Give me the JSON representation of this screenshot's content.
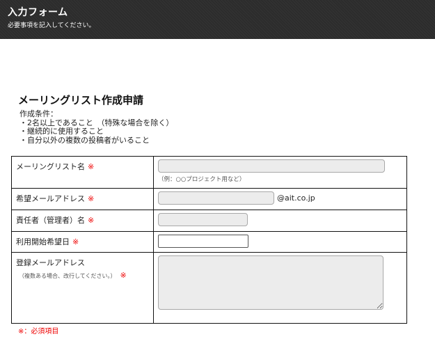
{
  "header": {
    "title": "入力フォーム",
    "subtitle": "必要事項を記入してください。"
  },
  "form": {
    "title": "メーリングリスト作成申請",
    "conditions_heading": "作成条件：",
    "conditions": [
      "・2名以上であること　（特殊な場合を除く）",
      "・継続的に使用すること",
      "・自分以外の複数の投稿者がいること"
    ],
    "required_mark": "※",
    "fields": {
      "ml_name": {
        "label": "メーリングリスト名",
        "value": "",
        "hint": "（例：○○プロジェクト用など）"
      },
      "address": {
        "label": "希望メールアドレス",
        "value": "",
        "domain": "@ait.co.jp"
      },
      "manager": {
        "label": "責任者（管理者）名",
        "value": ""
      },
      "start_date": {
        "label": "利用開始希望日",
        "value": ""
      },
      "members": {
        "label": "登録メールアドレス",
        "note": "（複数ある場合、改行してください。）",
        "value": ""
      }
    },
    "legend": "※：必須項目"
  },
  "colors": {
    "header_bg": "#2c2c2c",
    "required": "#e00000"
  }
}
